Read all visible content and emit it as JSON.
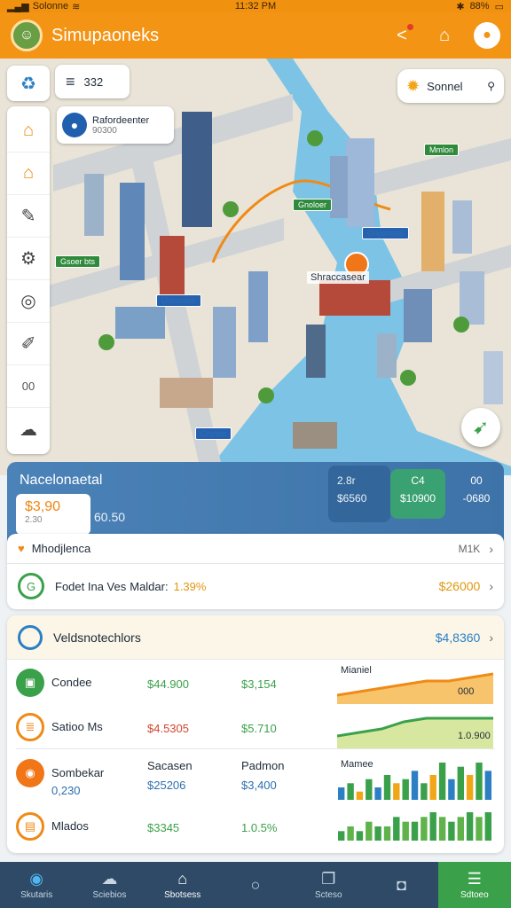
{
  "status_bar": {
    "carrier": "Solonne",
    "time": "11:32 PM",
    "battery": "88%"
  },
  "app": {
    "title": "Simupaoneks"
  },
  "map": {
    "menu_chip_value": "332",
    "info_card": {
      "title": "Rafordeenter",
      "subtitle": "90300"
    },
    "search_chip": {
      "label": "Sonnel"
    },
    "pin_label": "Shraccasear",
    "tags": [
      "Gsoer bts",
      "Mmlon",
      "Gnoloer",
      "Gnpsneas",
      "Uncrosoe",
      "Crunes"
    ]
  },
  "rail": {
    "text_item": "00"
  },
  "overview": {
    "title": "Nacelonaetal",
    "badge_value": "$3,90",
    "badge_sub": "2.30",
    "value": "60.50",
    "stat1_label": "2.8r",
    "stat1_value": "$6560",
    "stat2_label": "C4",
    "stat2_value": "$10900",
    "stat3_label": "00",
    "stat3_value": "-0680"
  },
  "list": {
    "row1": {
      "label": "Mhodjlenca",
      "value": "M1K"
    },
    "row2": {
      "label": "Fodet Ina Ves",
      "sub_label": "Maldar:",
      "pct": "1.39%",
      "amount": "$26000",
      "icon_text": "G"
    }
  },
  "stats": {
    "header": {
      "label": "Veldsnotechlors",
      "value": "$4,8360"
    },
    "rows": [
      {
        "label": "Condee",
        "c1": "$44.900",
        "c2": "$3,154",
        "spark_label": "Mianiel",
        "spark_value": "000"
      },
      {
        "label": "Satioo Ms",
        "c1": "$4.5305",
        "c2": "$5.710",
        "spark_value": "1.0.900"
      },
      {
        "label": "Sombekar",
        "sub": "0,230",
        "c1_label": "Sacasen",
        "c1": "$25206",
        "c2_label": "Padmon",
        "c2": "$3,400",
        "spark_label": "Mamee"
      },
      {
        "label": "Mlados",
        "c1": "$3345",
        "c2": "1.0.5%"
      }
    ]
  },
  "bottom_nav": [
    {
      "label": "Skutaris",
      "icon": "globe-icon"
    },
    {
      "label": "Sciebios",
      "icon": "cloud-icon"
    },
    {
      "label": "Sbotsess",
      "icon": "home-icon"
    },
    {
      "label": "",
      "icon": "circle-icon"
    },
    {
      "label": "Scteso",
      "icon": "book-icon"
    },
    {
      "label": "",
      "icon": "message-icon"
    },
    {
      "label": "Sdtoeo",
      "icon": "stack-icon"
    }
  ],
  "chart_data": [
    {
      "type": "area",
      "series": [
        {
          "values": [
            2,
            3,
            4,
            5,
            6,
            6,
            7,
            8
          ]
        }
      ]
    },
    {
      "type": "area",
      "series": [
        {
          "values": [
            3,
            4,
            5,
            7,
            8,
            8,
            8,
            8
          ]
        }
      ]
    },
    {
      "type": "bar",
      "values": [
        3,
        4,
        2,
        5,
        3,
        6,
        4,
        5,
        7,
        4,
        6,
        9,
        5,
        8,
        6,
        9,
        7
      ]
    },
    {
      "type": "bar",
      "values": [
        2,
        3,
        2,
        4,
        3,
        3,
        5,
        4,
        4,
        5,
        6,
        5,
        4,
        5,
        6,
        5,
        6
      ]
    }
  ]
}
